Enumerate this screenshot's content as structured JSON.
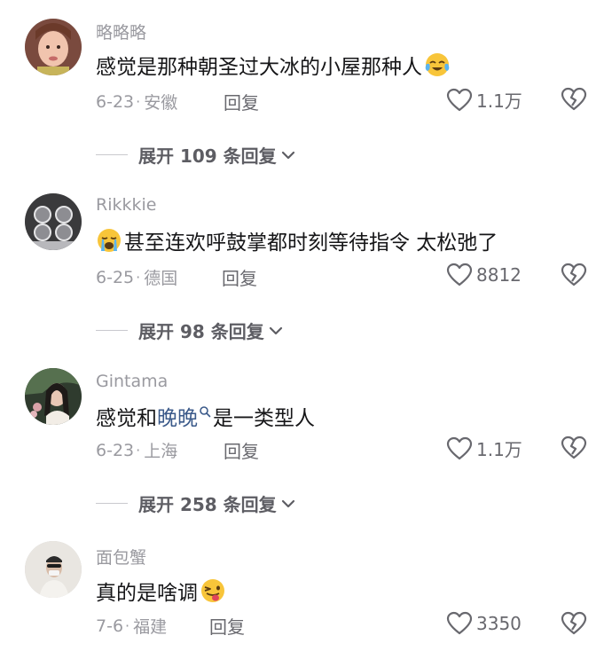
{
  "comments": [
    {
      "username": "略略略",
      "text_before": "感觉是那种朝圣过大冰的小屋那种人",
      "emoji_after": "tears-of-joy-emoji",
      "date": "6-23",
      "location": "安徽",
      "reply_label": "回复",
      "likes": "1.1万",
      "expand_label": "展开 109 条回复"
    },
    {
      "username": "Rikkkie",
      "emoji_before": "crying-emoji",
      "text_after": "甚至连欢呼鼓掌都时刻等待指令 太松弛了",
      "date": "6-25",
      "location": "德国",
      "reply_label": "回复",
      "likes": "8812",
      "expand_label": "展开 98 条回复"
    },
    {
      "username": "Gintama",
      "text_before": "感觉和",
      "link_word": "晚晚",
      "text_after": "是一类型人",
      "date": "6-23",
      "location": "上海",
      "reply_label": "回复",
      "likes": "1.1万",
      "expand_label": "展开 258 条回复"
    },
    {
      "username": "面包蟹",
      "text_before": "真的是啥调",
      "emoji_after": "winking-tongue-emoji",
      "date": "7-6",
      "location": "福建",
      "reply_label": "回复",
      "likes": "3350"
    }
  ],
  "meta_separator": "·",
  "colors": {
    "username": "#9a9aa0",
    "text": "#161618",
    "meta": "#9a9aa0",
    "link": "#3b5a8a",
    "icon": "#68686e"
  }
}
